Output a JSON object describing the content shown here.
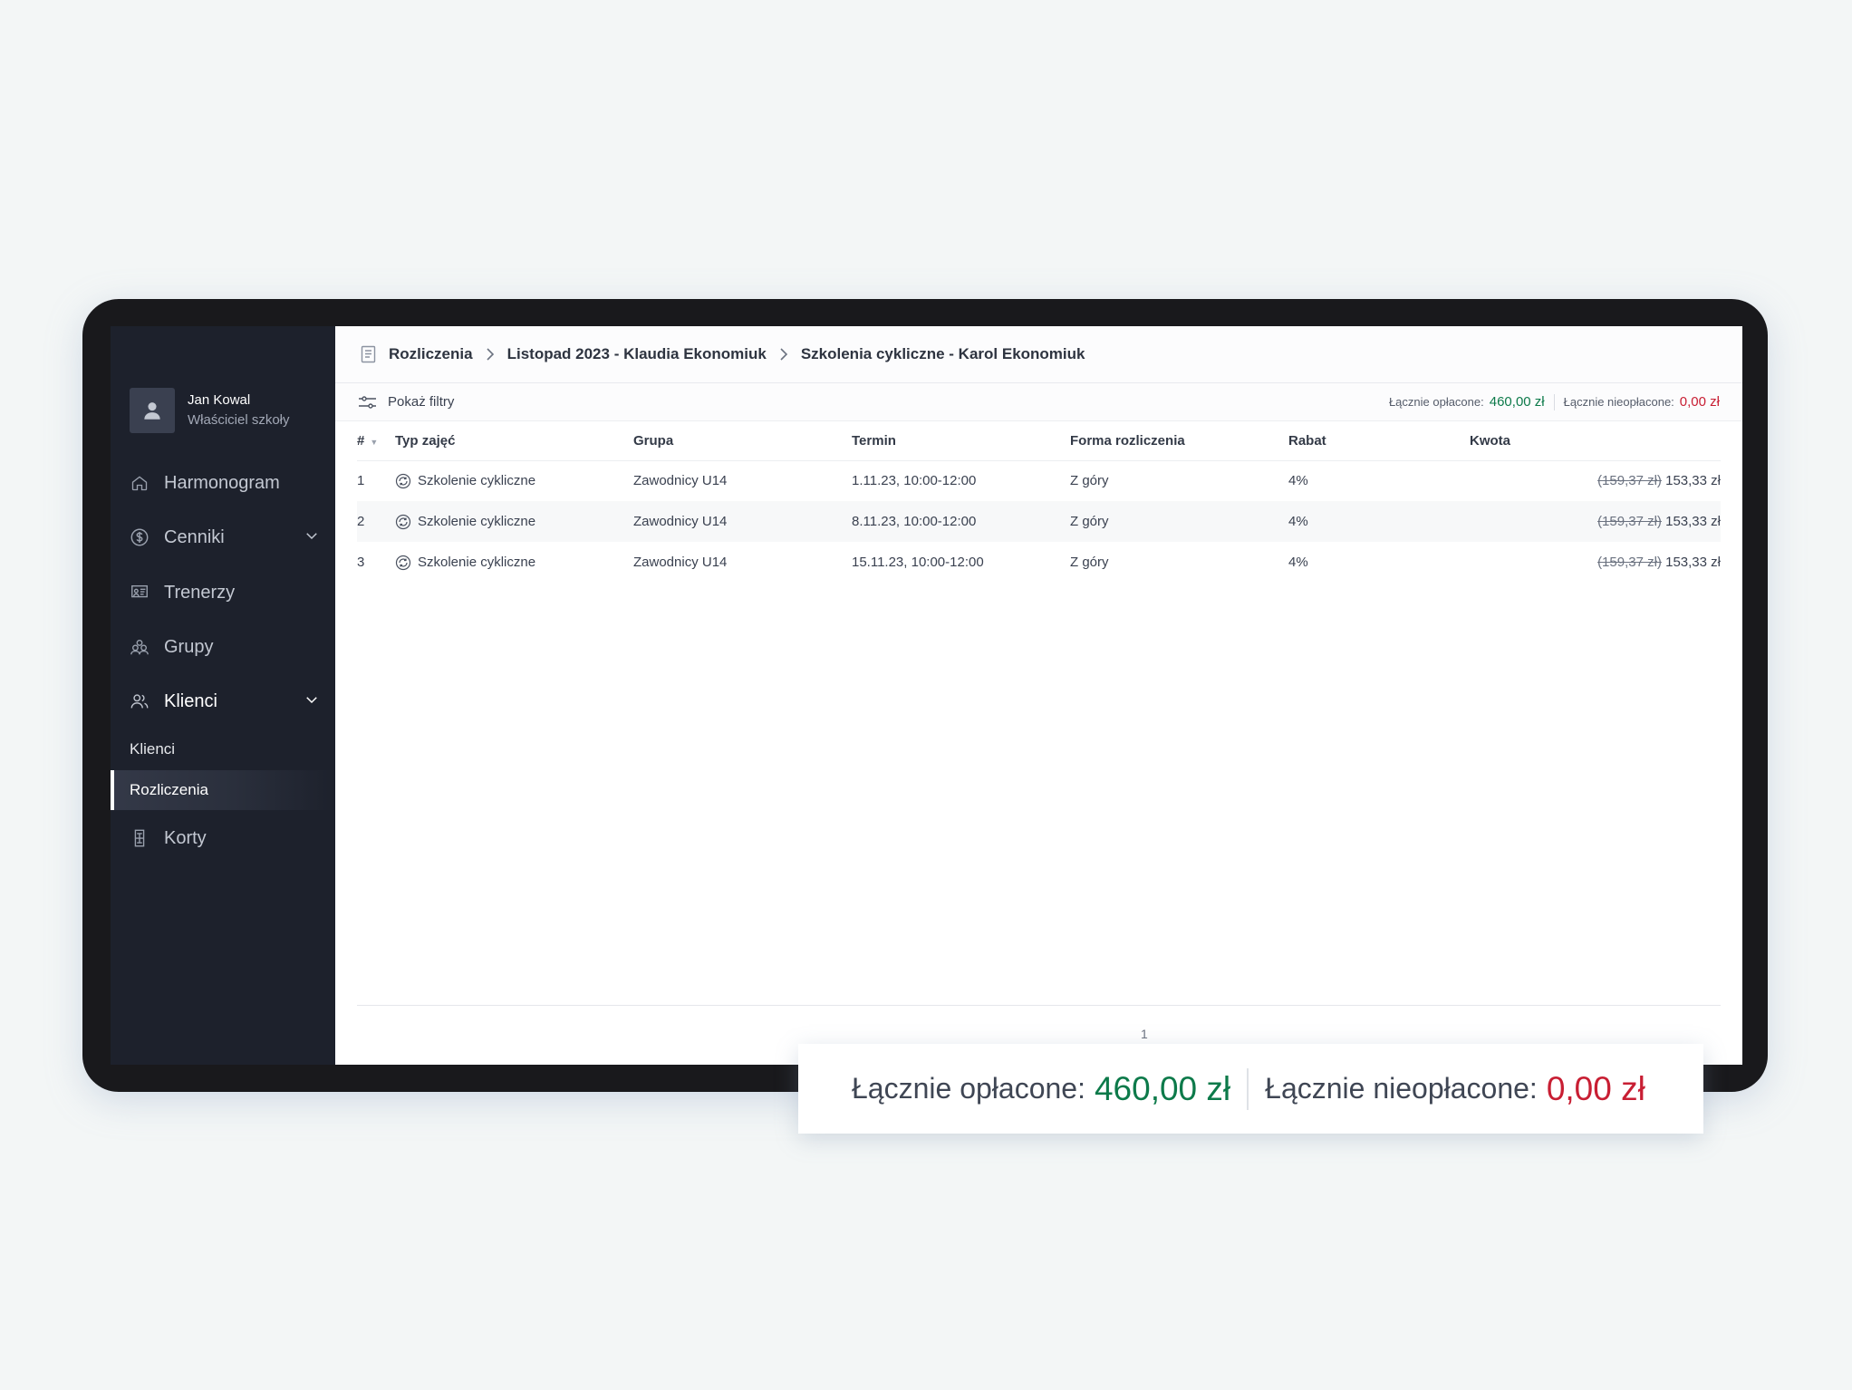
{
  "user": {
    "name": "Jan Kowal",
    "role": "Właściciel szkoły"
  },
  "sidebar": {
    "items": [
      {
        "label": "Harmonogram",
        "icon": "home-icon"
      },
      {
        "label": "Cenniki",
        "icon": "dollar-circle-icon",
        "has_chevron": true
      },
      {
        "label": "Trenerzy",
        "icon": "trainer-board-icon"
      },
      {
        "label": "Grupy",
        "icon": "group-icon"
      },
      {
        "label": "Klienci",
        "icon": "users-icon",
        "has_chevron": true,
        "expanded": true
      },
      {
        "label": "Korty",
        "icon": "court-icon"
      }
    ],
    "subitems": [
      {
        "label": "Klienci",
        "active": false
      },
      {
        "label": "Rozliczenia",
        "active": true
      }
    ]
  },
  "breadcrumb": {
    "items": [
      "Rozliczenia",
      "Listopad 2023 - Klaudia Ekonomiuk",
      "Szkolenia cykliczne - Karol Ekonomiuk"
    ]
  },
  "toolbar": {
    "filters_label": "Pokaż filtry",
    "paid_label": "Łącznie opłacone:",
    "paid_value": "460,00 zł",
    "unpaid_label": "Łącznie nieopłacone:",
    "unpaid_value": "0,00 zł"
  },
  "table": {
    "columns": [
      "#",
      "Typ zajęć",
      "Grupa",
      "Termin",
      "Forma rozliczenia",
      "Rabat",
      "Kwota"
    ],
    "rows": [
      {
        "no": "1",
        "type": "Szkolenie cykliczne",
        "group": "Zawodnicy U14",
        "date": "1.11.23, 10:00-12:00",
        "form": "Z góry",
        "discount": "4%",
        "old_price": "(159,37 zł)",
        "price": "153,33 zł"
      },
      {
        "no": "2",
        "type": "Szkolenie cykliczne",
        "group": "Zawodnicy U14",
        "date": "8.11.23, 10:00-12:00",
        "form": "Z góry",
        "discount": "4%",
        "old_price": "(159,37 zł)",
        "price": "153,33 zł"
      },
      {
        "no": "3",
        "type": "Szkolenie cykliczne",
        "group": "Zawodnicy U14",
        "date": "15.11.23, 10:00-12:00",
        "form": "Z góry",
        "discount": "4%",
        "old_price": "(159,37 zł)",
        "price": "153,33 zł"
      }
    ]
  },
  "pagination": {
    "current": "1"
  },
  "callout": {
    "paid_label": "Łącznie opłacone:",
    "paid_value": "460,00 zł",
    "unpaid_label": "Łącznie nieopłacone:",
    "unpaid_value": "0,00 zł"
  },
  "colors": {
    "paid": "#0d7a4a",
    "unpaid": "#c81e33",
    "sidebar_bg": "#1d212c"
  }
}
